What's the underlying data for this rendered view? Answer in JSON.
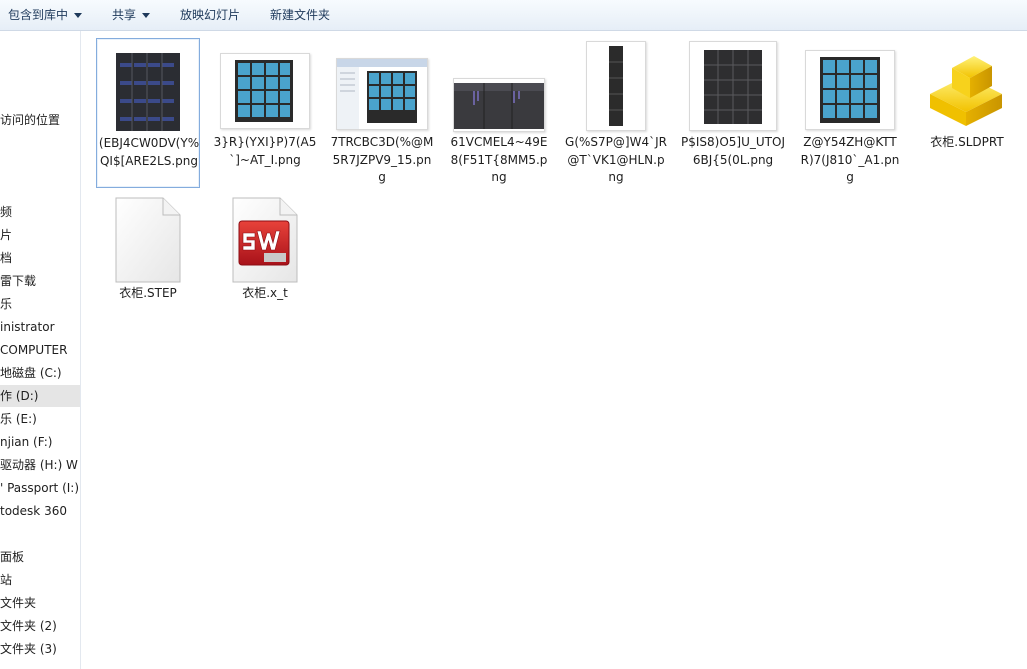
{
  "toolbar": {
    "include_library": "包含到库中",
    "share": "共享",
    "slideshow": "放映幻灯片",
    "new_folder": "新建文件夹"
  },
  "nav": {
    "items": [
      {
        "label": "访问的位置"
      },
      {
        "label": "频"
      },
      {
        "label": "片"
      },
      {
        "label": "档"
      },
      {
        "label": "雷下载"
      },
      {
        "label": "乐"
      },
      {
        "label": "inistrator"
      },
      {
        "label": "COMPUTER"
      },
      {
        "label": "地磁盘 (C:)"
      },
      {
        "label": "作 (D:)"
      },
      {
        "label": "乐 (E:)"
      },
      {
        "label": "njian (F:)"
      },
      {
        "label": " 驱动器 (H:) W"
      },
      {
        "label": "' Passport (I:)"
      },
      {
        "label": "todesk 360"
      },
      {
        "label": "面板"
      },
      {
        "label": "站"
      },
      {
        "label": "文件夹"
      },
      {
        "label": "文件夹 (2)"
      },
      {
        "label": "文件夹 (3)"
      }
    ]
  },
  "files": [
    {
      "name": "(EBJ4CW0DV(Y%QI$[ARE2LS.png",
      "icon": "wardrobe-dark-icon"
    },
    {
      "name": "3}R}(YXI}P)7(A5`]~AT_I.png",
      "icon": "wardrobe-blue-icon"
    },
    {
      "name": "7TRCBC3D(%@M5R7JZPV9_15.png",
      "icon": "screenshot-icon"
    },
    {
      "name": "61VCMEL4~49E8(F51T{8MM5.png",
      "icon": "wardrobe-wide-icon"
    },
    {
      "name": "G(%S7P@]W4`JR@T`VK1@HLN.png",
      "icon": "wardrobe-tall-icon"
    },
    {
      "name": "P$IS8)O5]U_UTOJ6BJ{5(0L.png",
      "icon": "wardrobe-black-icon"
    },
    {
      "name": "Z@Y54ZH@KTTR)7(J810`_A1.png",
      "icon": "wardrobe-blue-icon"
    },
    {
      "name": "衣柜.SLDPRT",
      "icon": "solidworks-part-icon"
    },
    {
      "name": "衣柜.STEP",
      "icon": "blank-document-icon"
    },
    {
      "name": "衣柜.x_t",
      "icon": "solidworks-app-icon"
    }
  ],
  "colors": {
    "selection_border": "#84acdd",
    "toolbar_text": "#1e395b",
    "cube_blue": "#4aa3cc"
  }
}
